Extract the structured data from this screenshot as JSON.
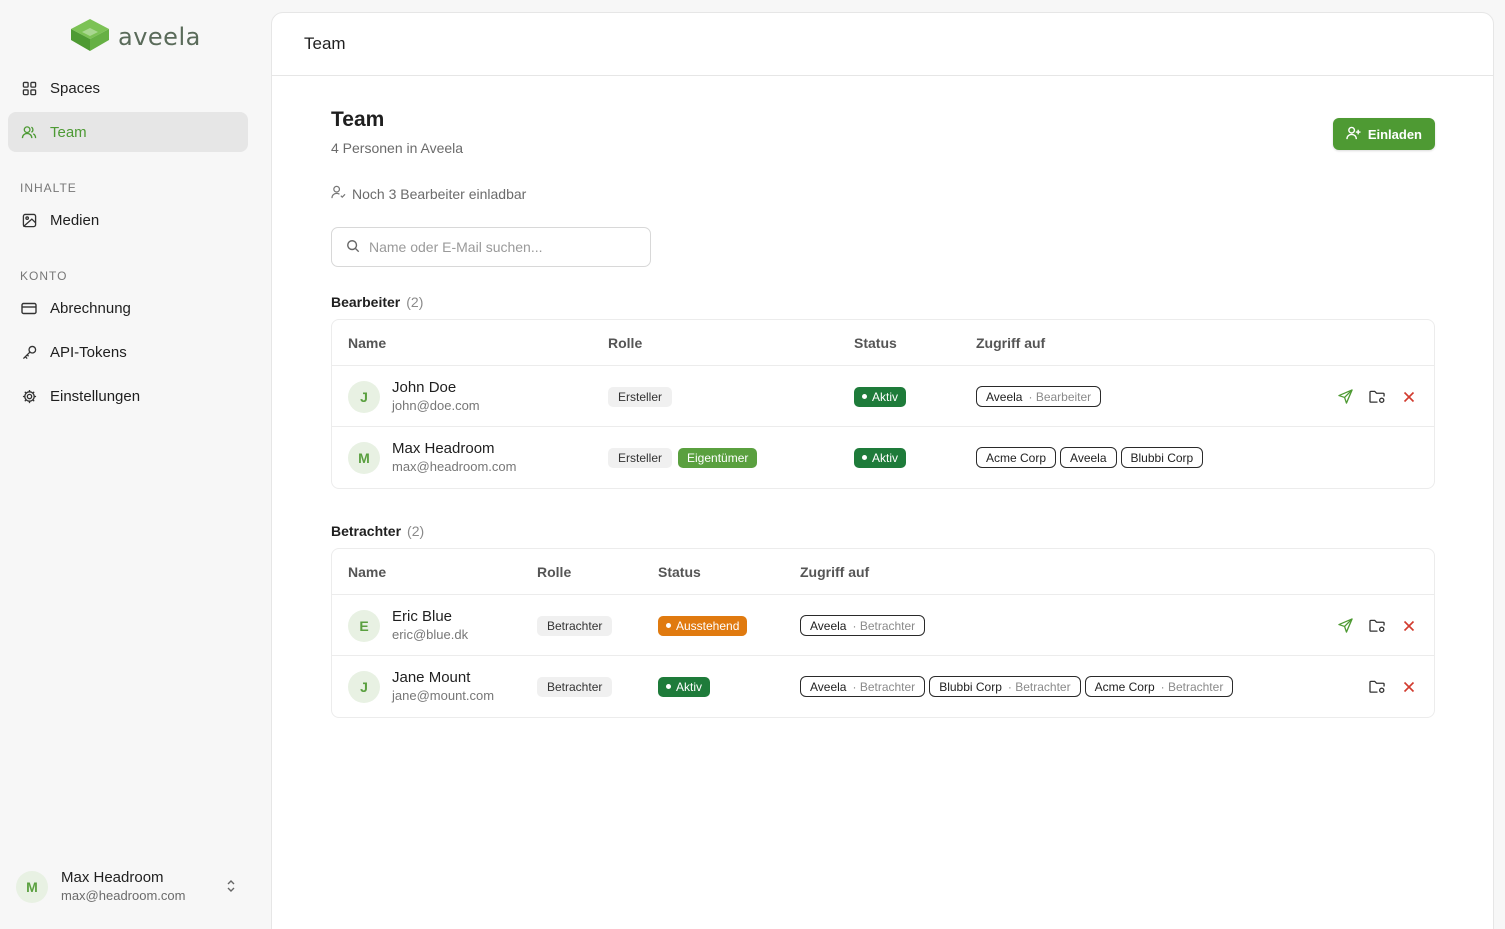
{
  "sidebar": {
    "logo_text": "aveela",
    "nav": [
      {
        "label": "Spaces",
        "icon": "grid-icon",
        "active": false
      },
      {
        "label": "Team",
        "icon": "users-icon",
        "active": true
      }
    ],
    "section_content": "INHALTE",
    "content_items": [
      {
        "label": "Medien",
        "icon": "image-icon"
      }
    ],
    "section_account": "KONTO",
    "account_items": [
      {
        "label": "Abrechnung",
        "icon": "credit-card-icon"
      },
      {
        "label": "API-Tokens",
        "icon": "key-icon"
      },
      {
        "label": "Einstellungen",
        "icon": "gear-icon"
      }
    ],
    "user": {
      "initial": "M",
      "name": "Max Headroom",
      "email": "max@headroom.com"
    }
  },
  "topbar": {
    "title": "Team"
  },
  "page": {
    "title": "Team",
    "subtitle": "4 Personen in Aveela",
    "invite_label": "Einladen",
    "quota_text": "Noch 3 Bearbeiter einladbar",
    "search_placeholder": "Name oder E-Mail suchen..."
  },
  "editors": {
    "heading": "Bearbeiter",
    "count": "(2)",
    "columns": {
      "name": "Name",
      "role": "Rolle",
      "status": "Status",
      "access": "Zugriff auf"
    },
    "rows": [
      {
        "initial": "J",
        "name": "John Doe",
        "email": "john@doe.com",
        "role": "Ersteller",
        "owner": "",
        "status": "Aktiv",
        "access": [
          {
            "name": "Aveela",
            "role": "· Bearbeiter"
          }
        ]
      },
      {
        "initial": "M",
        "name": "Max Headroom",
        "email": "max@headroom.com",
        "role": "Ersteller",
        "owner": "Eigentümer",
        "status": "Aktiv",
        "access": [
          {
            "name": "Acme Corp",
            "role": ""
          },
          {
            "name": "Aveela",
            "role": ""
          },
          {
            "name": "Blubbi Corp",
            "role": ""
          }
        ]
      }
    ]
  },
  "viewers": {
    "heading": "Betrachter",
    "count": "(2)",
    "columns": {
      "name": "Name",
      "role": "Rolle",
      "status": "Status",
      "access": "Zugriff auf"
    },
    "rows": [
      {
        "initial": "E",
        "name": "Eric Blue",
        "email": "eric@blue.dk",
        "role": "Betrachter",
        "status": "Ausstehend",
        "access": [
          {
            "name": "Aveela",
            "role": "· Betrachter"
          }
        ]
      },
      {
        "initial": "J",
        "name": "Jane Mount",
        "email": "jane@mount.com",
        "role": "Betrachter",
        "status": "Aktiv",
        "access": [
          {
            "name": "Aveela",
            "role": "· Betrachter"
          },
          {
            "name": "Blubbi Corp",
            "role": "· Betrachter"
          },
          {
            "name": "Acme Corp",
            "role": "· Betrachter"
          }
        ]
      }
    ]
  },
  "colors": {
    "accent": "#4e9a33",
    "status_active": "#1e7b3a",
    "status_pending": "#e07a0f",
    "danger": "#d23b2f"
  }
}
